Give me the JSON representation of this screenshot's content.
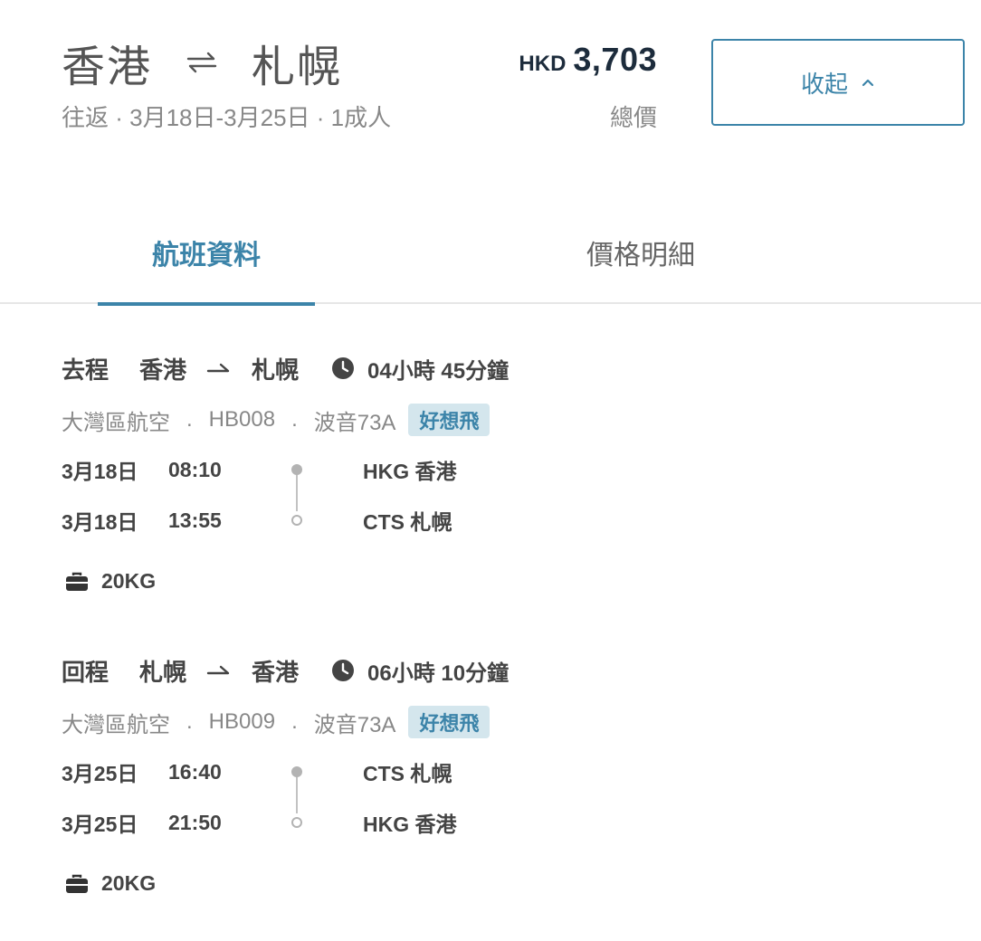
{
  "header": {
    "origin": "香港",
    "destination": "札幌",
    "trip_meta": "往返 · 3月18日-3月25日 · 1成人",
    "currency": "HKD",
    "total_price": "3,703",
    "price_label": "總價",
    "collapse_label": "收起"
  },
  "tabs": [
    {
      "label": "航班資料",
      "active": true
    },
    {
      "label": "價格明細",
      "active": false
    }
  ],
  "segments": [
    {
      "direction": "去程",
      "from": "香港",
      "to": "札幌",
      "duration": "04小時 45分鐘",
      "airline": "大灣區航空",
      "flight_no": "HB008",
      "aircraft": "波音73A",
      "fare_brand": "好想飛",
      "departure": {
        "date": "3月18日",
        "time": "08:10",
        "airport": "HKG 香港"
      },
      "arrival": {
        "date": "3月18日",
        "time": "13:55",
        "airport": "CTS 札幌"
      },
      "baggage": "20KG"
    },
    {
      "direction": "回程",
      "from": "札幌",
      "to": "香港",
      "duration": "06小時 10分鐘",
      "airline": "大灣區航空",
      "flight_no": "HB009",
      "aircraft": "波音73A",
      "fare_brand": "好想飛",
      "departure": {
        "date": "3月25日",
        "time": "16:40",
        "airport": "CTS 札幌"
      },
      "arrival": {
        "date": "3月25日",
        "time": "21:50",
        "airport": "HKG 香港"
      },
      "baggage": "20KG"
    }
  ],
  "separator": ".",
  "colors": {
    "accent": "#3c84a9",
    "price": "#1d2c3c",
    "badge_bg": "#d4e6ed",
    "muted_text": "#888888"
  },
  "icons": {
    "swap": "swap-arrows-icon",
    "collapse": "chevron-up-icon",
    "route_arrow": "arrow-right-icon",
    "duration": "clock-icon",
    "baggage": "briefcase-icon"
  }
}
